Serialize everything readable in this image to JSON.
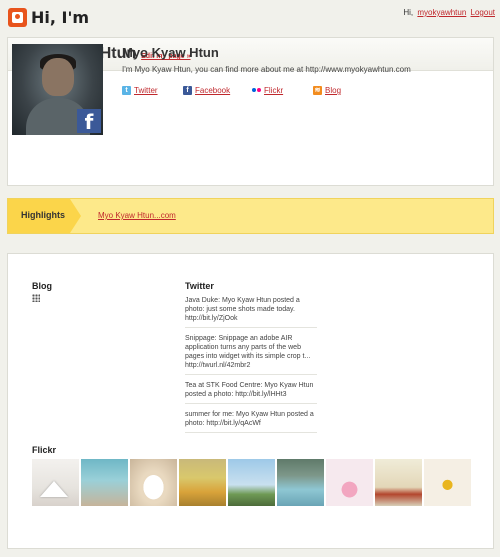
{
  "header": {
    "logo_text": "Hi, I'm",
    "greeting": "Hi,",
    "username": "myokyawhtun",
    "logout_label": "Logout"
  },
  "profile": {
    "name": "Myo Kyaw Htun",
    "edit_link": "Edit my page »",
    "title": "Myo Kyaw Htun",
    "description": "I'm Myo Kyaw Htun, you can find more about me at http://www.myokyawhtun.com",
    "avatar_badge": "f",
    "social": [
      {
        "label": "Twitter",
        "icon": "twitter-icon"
      },
      {
        "label": "Facebook",
        "icon": "facebook-icon"
      },
      {
        "label": "Flickr",
        "icon": "flickr-icon"
      },
      {
        "label": "Blog",
        "icon": "rss-icon"
      }
    ]
  },
  "highlights": {
    "label": "Highlights",
    "link": "Myo Kyaw Htun...com"
  },
  "blog": {
    "title": "Blog"
  },
  "twitter": {
    "title": "Twitter",
    "tweets": [
      "Java Duke: Myo Kyaw Htun posted a photo: just some shots made today. http://bit.ly/ZjOok",
      "Snippage: Snippage an adobe AIR application turns any parts of the web pages into widget with its simple crop t... http://twurl.nl/42mbr2",
      "Tea at STK Food Centre: Myo Kyaw Htun posted a photo: http://bit.ly/lHHt3",
      "summer for me: Myo Kyaw Htun posted a photo: http://bit.ly/qAcWf"
    ]
  },
  "flickr": {
    "title": "Flickr",
    "photo_count": 9
  },
  "colors": {
    "link": "#c0282d",
    "highlight_bg": "#fde98a",
    "highlight_tab": "#fbd54a",
    "logo": "#e8541c"
  }
}
